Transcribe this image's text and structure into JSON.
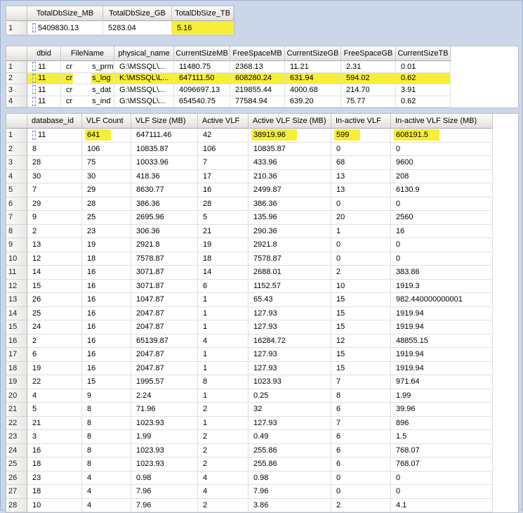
{
  "highlights": {
    "color": "#f7ee38",
    "grid1_cells": [
      [
        0,
        2
      ]
    ],
    "grid2_rows": [
      1
    ],
    "grid3_cells": [
      [
        0,
        1
      ],
      [
        0,
        4
      ],
      [
        0,
        5
      ],
      [
        0,
        6
      ]
    ]
  },
  "grids": {
    "grid1": {
      "title": "total-db-size-result-grid",
      "columns": [
        "TotalDbSize_MB",
        "TotalDbSize_GB",
        "TotalDbSize_TB"
      ],
      "rows": [
        [
          "5409830.13",
          "5283.04",
          "5.16"
        ]
      ]
    },
    "grid2": {
      "title": "database-files-result-grid",
      "columns": [
        "dbid",
        "FileName",
        "physical_name",
        "CurrentSizeMB",
        "FreeSpaceMB",
        "CurrentSizeGB",
        "FreeSpaceGB",
        "CurrentSizeTB"
      ],
      "rows": [
        [
          "11",
          [
            "cr",
            "s_prm"
          ],
          "G:\\MSSQL\\...",
          "11480.75",
          "2368.13",
          "11.21",
          "2.31",
          "0.01"
        ],
        [
          "11",
          [
            "cr",
            "s_log"
          ],
          "K:\\MSSQL\\L...",
          "647111.50",
          "608280.24",
          "631.94",
          "594.02",
          "0.62"
        ],
        [
          "11",
          [
            "cr",
            "s_dat"
          ],
          "G:\\MSSQL\\...",
          "4096697.13",
          "219855.44",
          "4000.68",
          "214.70",
          "3.91"
        ],
        [
          "11",
          [
            "cr",
            "s_ind"
          ],
          "G:\\MSSQL\\...",
          "654540.75",
          "77584.94",
          "639.20",
          "75.77",
          "0.62"
        ]
      ]
    },
    "grid3": {
      "title": "vlf-result-grid",
      "columns": [
        "database_id",
        "VLF Count",
        "VLF Size (MB)",
        "Active VLF",
        "Active VLF Size (MB)",
        "In-active VLF",
        "In-active VLF Size (MB)"
      ],
      "rows": [
        [
          "11",
          "641",
          "647111.46",
          "42",
          "38919.96",
          "599",
          "608191.5"
        ],
        [
          "8",
          "106",
          "10835.87",
          "106",
          "10835.87",
          "0",
          "0"
        ],
        [
          "28",
          "75",
          "10033.96",
          "7",
          "433.96",
          "68",
          "9600"
        ],
        [
          "30",
          "30",
          "418.36",
          "17",
          "210.36",
          "13",
          "208"
        ],
        [
          "7",
          "29",
          "8630.77",
          "16",
          "2499.87",
          "13",
          "6130.9"
        ],
        [
          "29",
          "28",
          "386.36",
          "28",
          "386.36",
          "0",
          "0"
        ],
        [
          "9",
          "25",
          "2695.96",
          "5",
          "135.96",
          "20",
          "2560"
        ],
        [
          "2",
          "23",
          "306.36",
          "21",
          "290.36",
          "1",
          "16"
        ],
        [
          "13",
          "19",
          "2921.8",
          "19",
          "2921.8",
          "0",
          "0"
        ],
        [
          "12",
          "18",
          "7578.87",
          "18",
          "7578.87",
          "0",
          "0"
        ],
        [
          "14",
          "16",
          "3071.87",
          "14",
          "2688.01",
          "2",
          "383.86"
        ],
        [
          "15",
          "16",
          "3071.87",
          "6",
          "1152.57",
          "10",
          "1919.3"
        ],
        [
          "26",
          "16",
          "1047.87",
          "1",
          "65.43",
          "15",
          "982.440000000001"
        ],
        [
          "25",
          "16",
          "2047.87",
          "1",
          "127.93",
          "15",
          "1919.94"
        ],
        [
          "24",
          "16",
          "2047.87",
          "1",
          "127.93",
          "15",
          "1919.94"
        ],
        [
          "2",
          "16",
          "65139.87",
          "4",
          "16284.72",
          "12",
          "48855.15"
        ],
        [
          "6",
          "16",
          "2047.87",
          "1",
          "127.93",
          "15",
          "1919.94"
        ],
        [
          "19",
          "16",
          "2047.87",
          "1",
          "127.93",
          "15",
          "1919.94"
        ],
        [
          "22",
          "15",
          "1995.57",
          "8",
          "1023.93",
          "7",
          "971.64"
        ],
        [
          "4",
          "9",
          "2.24",
          "1",
          "0.25",
          "8",
          "1.99"
        ],
        [
          "5",
          "8",
          "71.96",
          "2",
          "32",
          "6",
          "39.96"
        ],
        [
          "21",
          "8",
          "1023.93",
          "1",
          "127.93",
          "7",
          "896"
        ],
        [
          "3",
          "8",
          "1.99",
          "2",
          "0.49",
          "6",
          "1.5"
        ],
        [
          "16",
          "8",
          "1023.93",
          "2",
          "255.86",
          "6",
          "768.07"
        ],
        [
          "18",
          "8",
          "1023.93",
          "2",
          "255.86",
          "6",
          "768.07"
        ],
        [
          "23",
          "4",
          "0.98",
          "4",
          "0.98",
          "0",
          "0"
        ],
        [
          "18",
          "4",
          "7.96",
          "4",
          "7.96",
          "0",
          "0"
        ],
        [
          "10",
          "4",
          "7.96",
          "2",
          "3.86",
          "2",
          "4.1"
        ]
      ]
    }
  }
}
